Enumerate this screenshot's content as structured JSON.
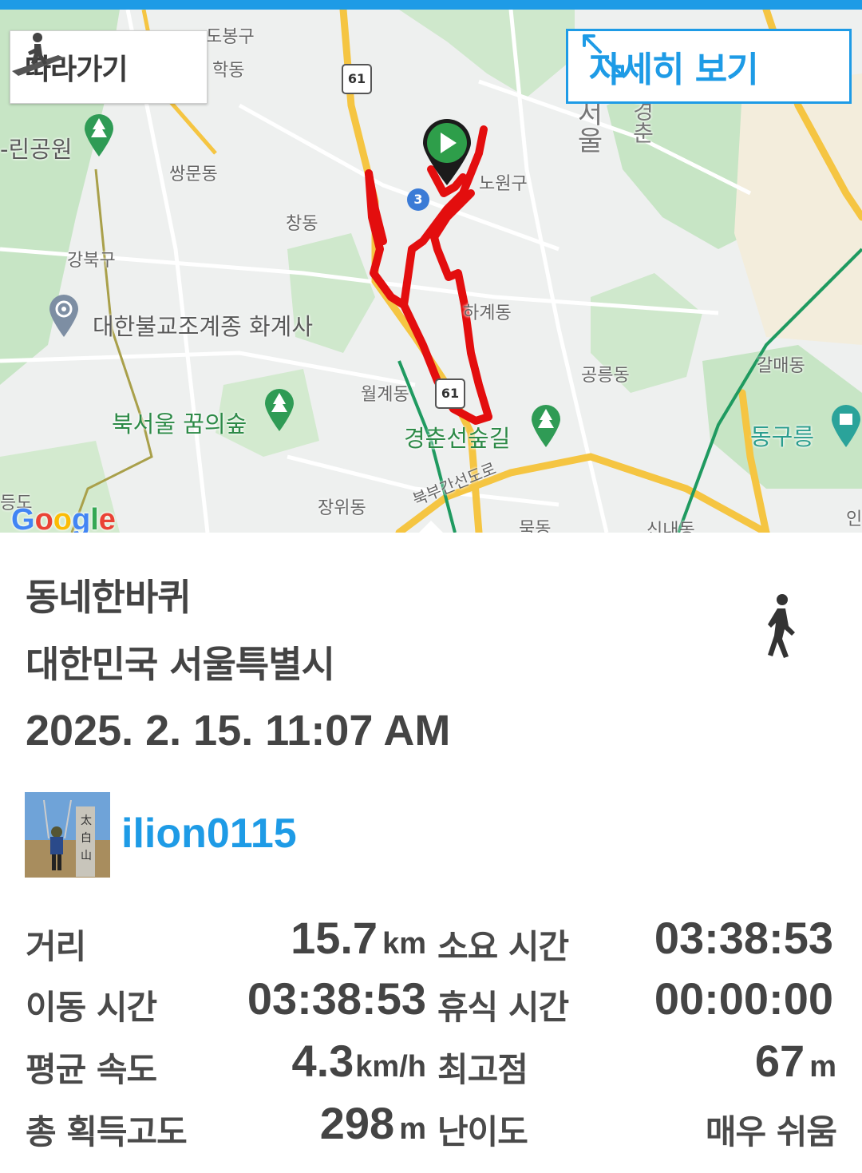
{
  "map": {
    "follow_label": "따라가기",
    "detail_label": "자세히 보기",
    "google_letters": [
      {
        "ch": "G",
        "color": "#4285F4"
      },
      {
        "ch": "o",
        "color": "#EA4335"
      },
      {
        "ch": "o",
        "color": "#FBBC05"
      },
      {
        "ch": "g",
        "color": "#4285F4"
      },
      {
        "ch": "l",
        "color": "#34A853"
      },
      {
        "ch": "e",
        "color": "#EA4335"
      }
    ],
    "labels": {
      "dobong": "도봉구",
      "hakdong": "학동",
      "rin_park": "-린공원",
      "ssangmun": "쌍문동",
      "changdong": "창동",
      "gangbuk": "강북구",
      "hwagyesa": "대한불교조계종 화계사",
      "bukseoul": "북서울 꿈의숲",
      "nowon": "노원구",
      "hagye": "하계동",
      "wolgye": "월계동",
      "gyeongchun": "경춘선숲길",
      "gongneung": "공릉동",
      "galmae": "갈매동",
      "donggureung": "동구릉",
      "jangwi": "장위동",
      "bukbu": "북부간선도로",
      "mukdong": "묵동",
      "sinnae": "신내동",
      "seoul_vertical": "서울",
      "gyeong_vertical": "경춘",
      "route_61_top": "61",
      "route_61_bottom": "61",
      "line_3": "3",
      "edge_left": "등도",
      "edge_right": "인"
    },
    "route_color": "#e30e0e",
    "start_marker_color": "#2e9e4a"
  },
  "track": {
    "title": "동네한바퀴",
    "location": "대한민국 서울특별시",
    "date": "2025. 2. 15. 11:07 AM",
    "activity_icon": "walking-icon"
  },
  "user": {
    "username": "ilion0115",
    "avatar_icon": "user-avatar-photo"
  },
  "stats": {
    "distance_label": "거리",
    "distance_value": "15.7",
    "distance_unit": "km",
    "total_time_label": "소요 시간",
    "total_time_value": "03:38:53",
    "moving_time_label": "이동 시간",
    "moving_time_value": "03:38:53",
    "rest_time_label": "휴식 시간",
    "rest_time_value": "00:00:00",
    "avg_speed_label": "평균 속도",
    "avg_speed_value": "4.3",
    "avg_speed_unit": "km/h",
    "max_alt_label": "최고점",
    "max_alt_value": "67",
    "max_alt_unit": "m",
    "total_ascent_label": "총 획득고도",
    "total_ascent_value": "298",
    "total_ascent_unit": "m",
    "difficulty_label": "난이도",
    "difficulty_value": "매우 쉬움"
  }
}
